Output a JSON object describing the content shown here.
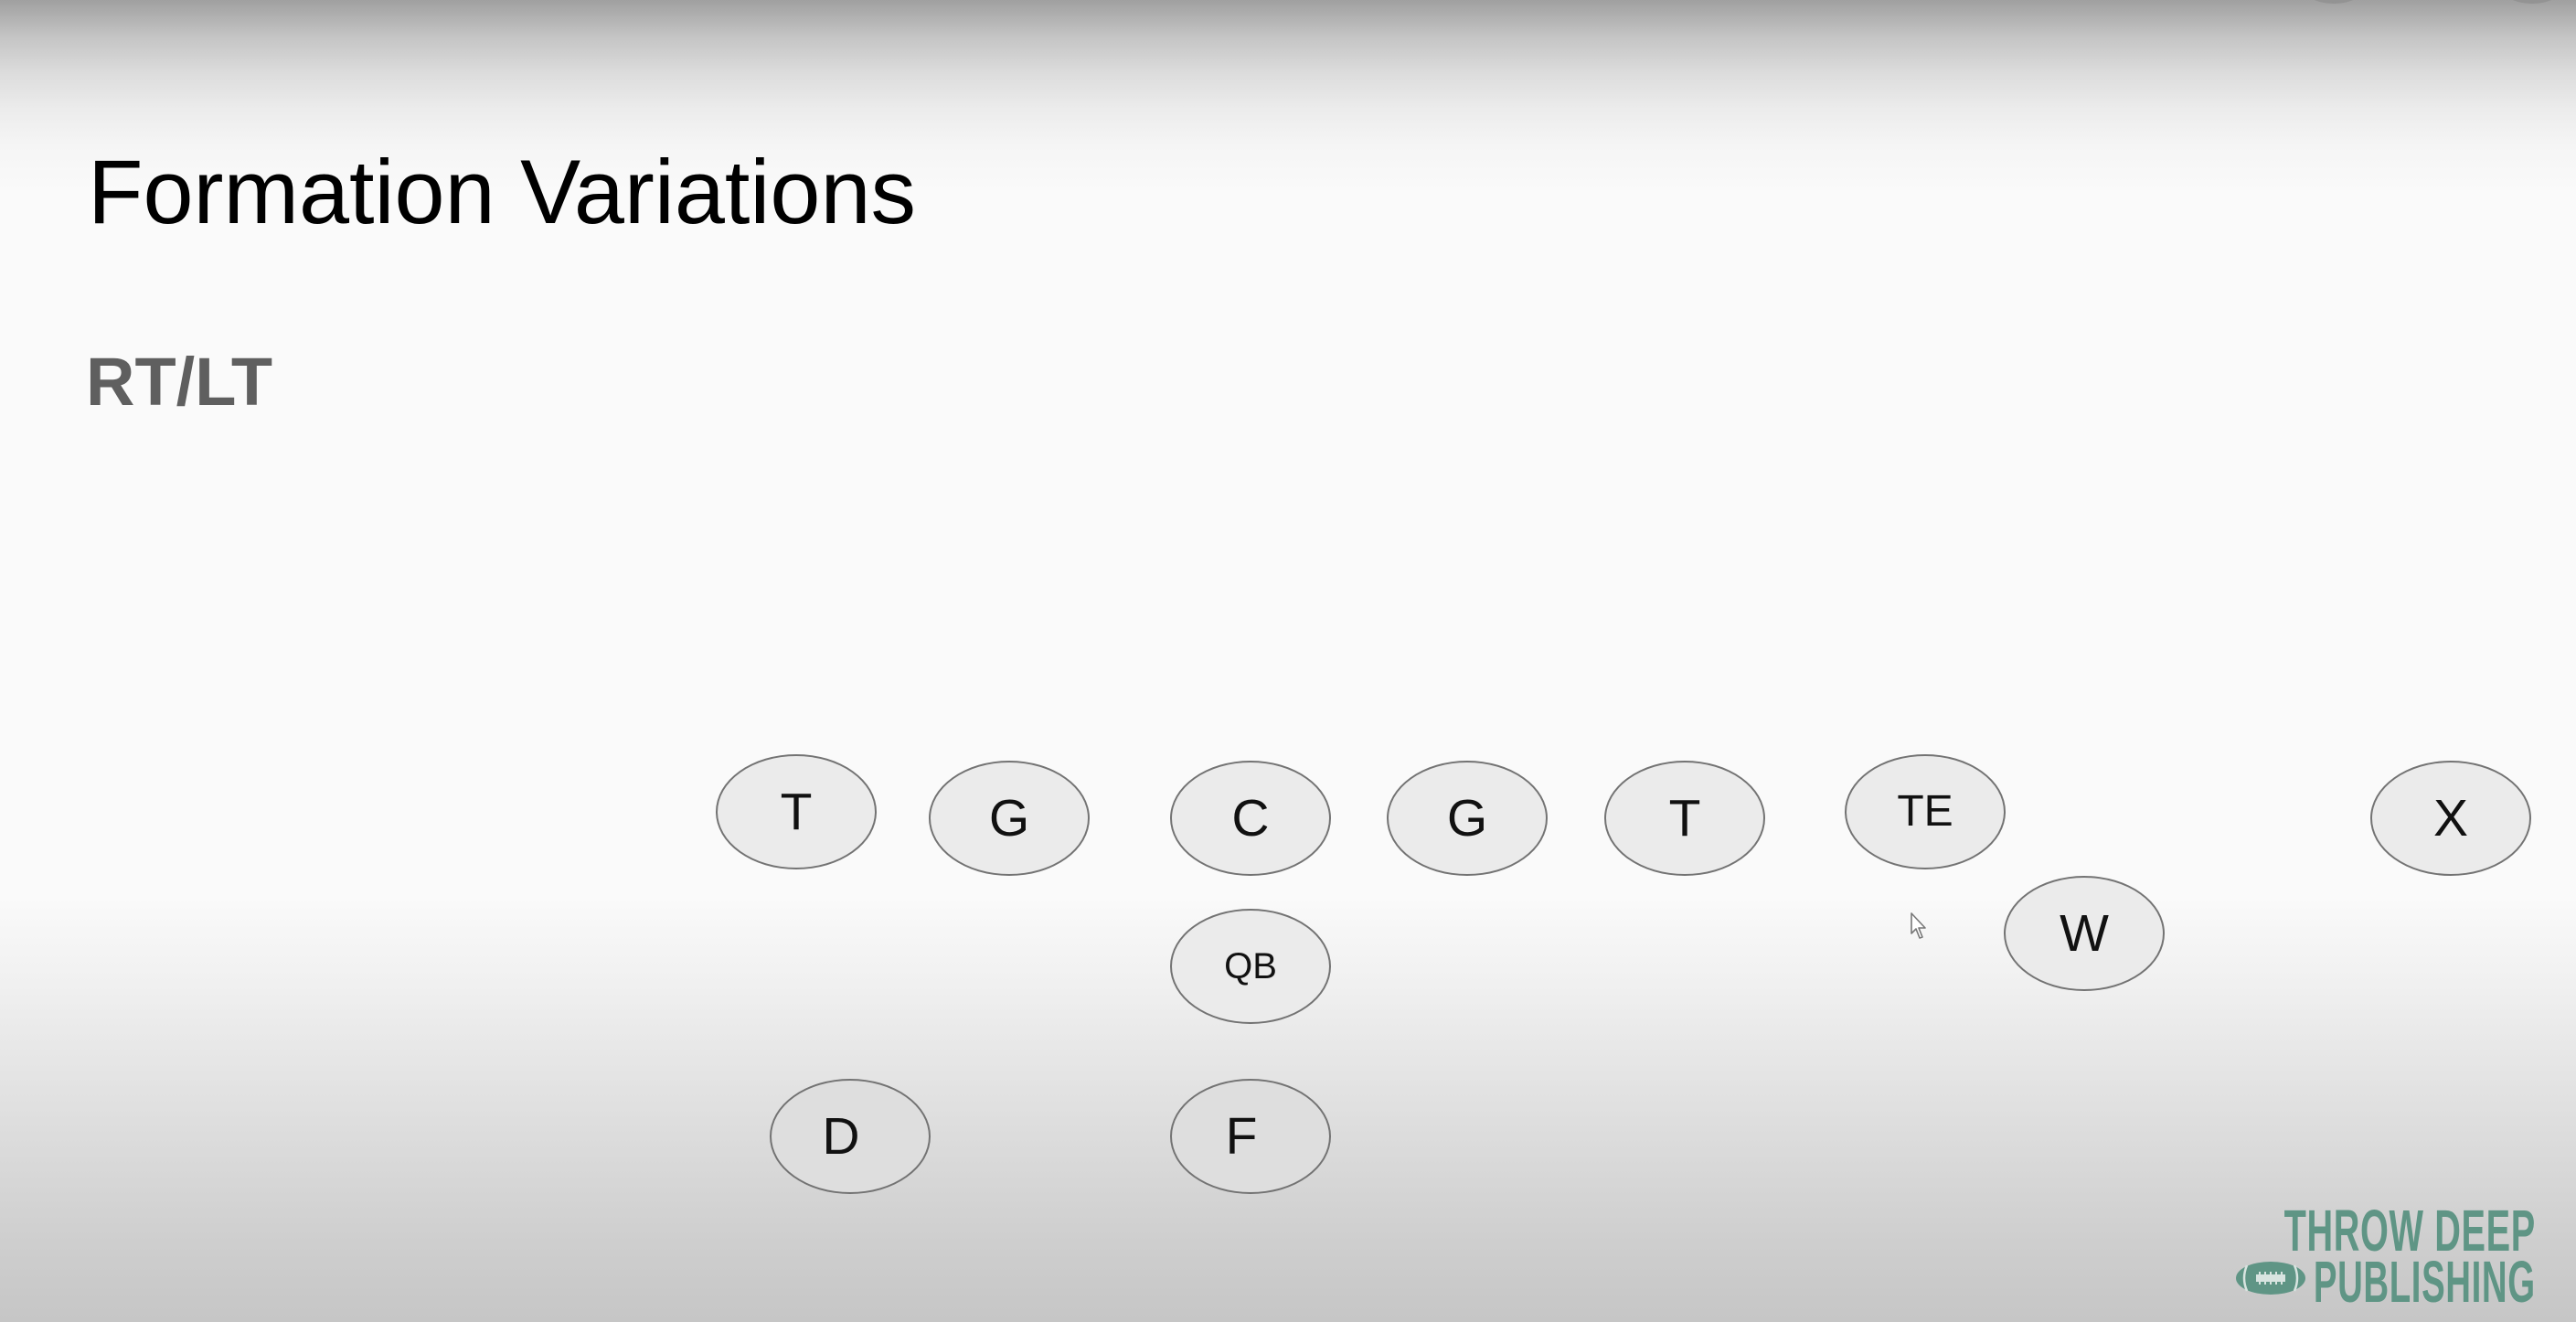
{
  "slide": {
    "title": "Formation Variations",
    "subtitle": "RT/LT"
  },
  "formation": {
    "players": [
      {
        "label": "T",
        "role": "left-tackle",
        "row": "line"
      },
      {
        "label": "G",
        "role": "left-guard",
        "row": "line"
      },
      {
        "label": "C",
        "role": "center",
        "row": "line"
      },
      {
        "label": "G",
        "role": "right-guard",
        "row": "line"
      },
      {
        "label": "T",
        "role": "right-tackle",
        "row": "line"
      },
      {
        "label": "TE",
        "role": "tight-end",
        "row": "line"
      },
      {
        "label": "X",
        "role": "split-end",
        "row": "line"
      },
      {
        "label": "W",
        "role": "wing",
        "row": "off-line"
      },
      {
        "label": "QB",
        "role": "quarterback",
        "row": "backfield"
      },
      {
        "label": "D",
        "role": "back-d",
        "row": "deep-backfield"
      },
      {
        "label": "F",
        "role": "fullback",
        "row": "deep-backfield"
      }
    ],
    "colors": {
      "fill": "#ebebeb",
      "stroke": "#737373",
      "label": "#111111"
    }
  },
  "branding": {
    "line1": "THROW DEEP",
    "line2": "PUBLISHING",
    "icon": "football-icon",
    "color": "#5f9585"
  },
  "overlay": {
    "icons": [
      "overlay-button-icon",
      "overlay-button-icon"
    ],
    "cursor": "mouse-pointer-icon"
  }
}
